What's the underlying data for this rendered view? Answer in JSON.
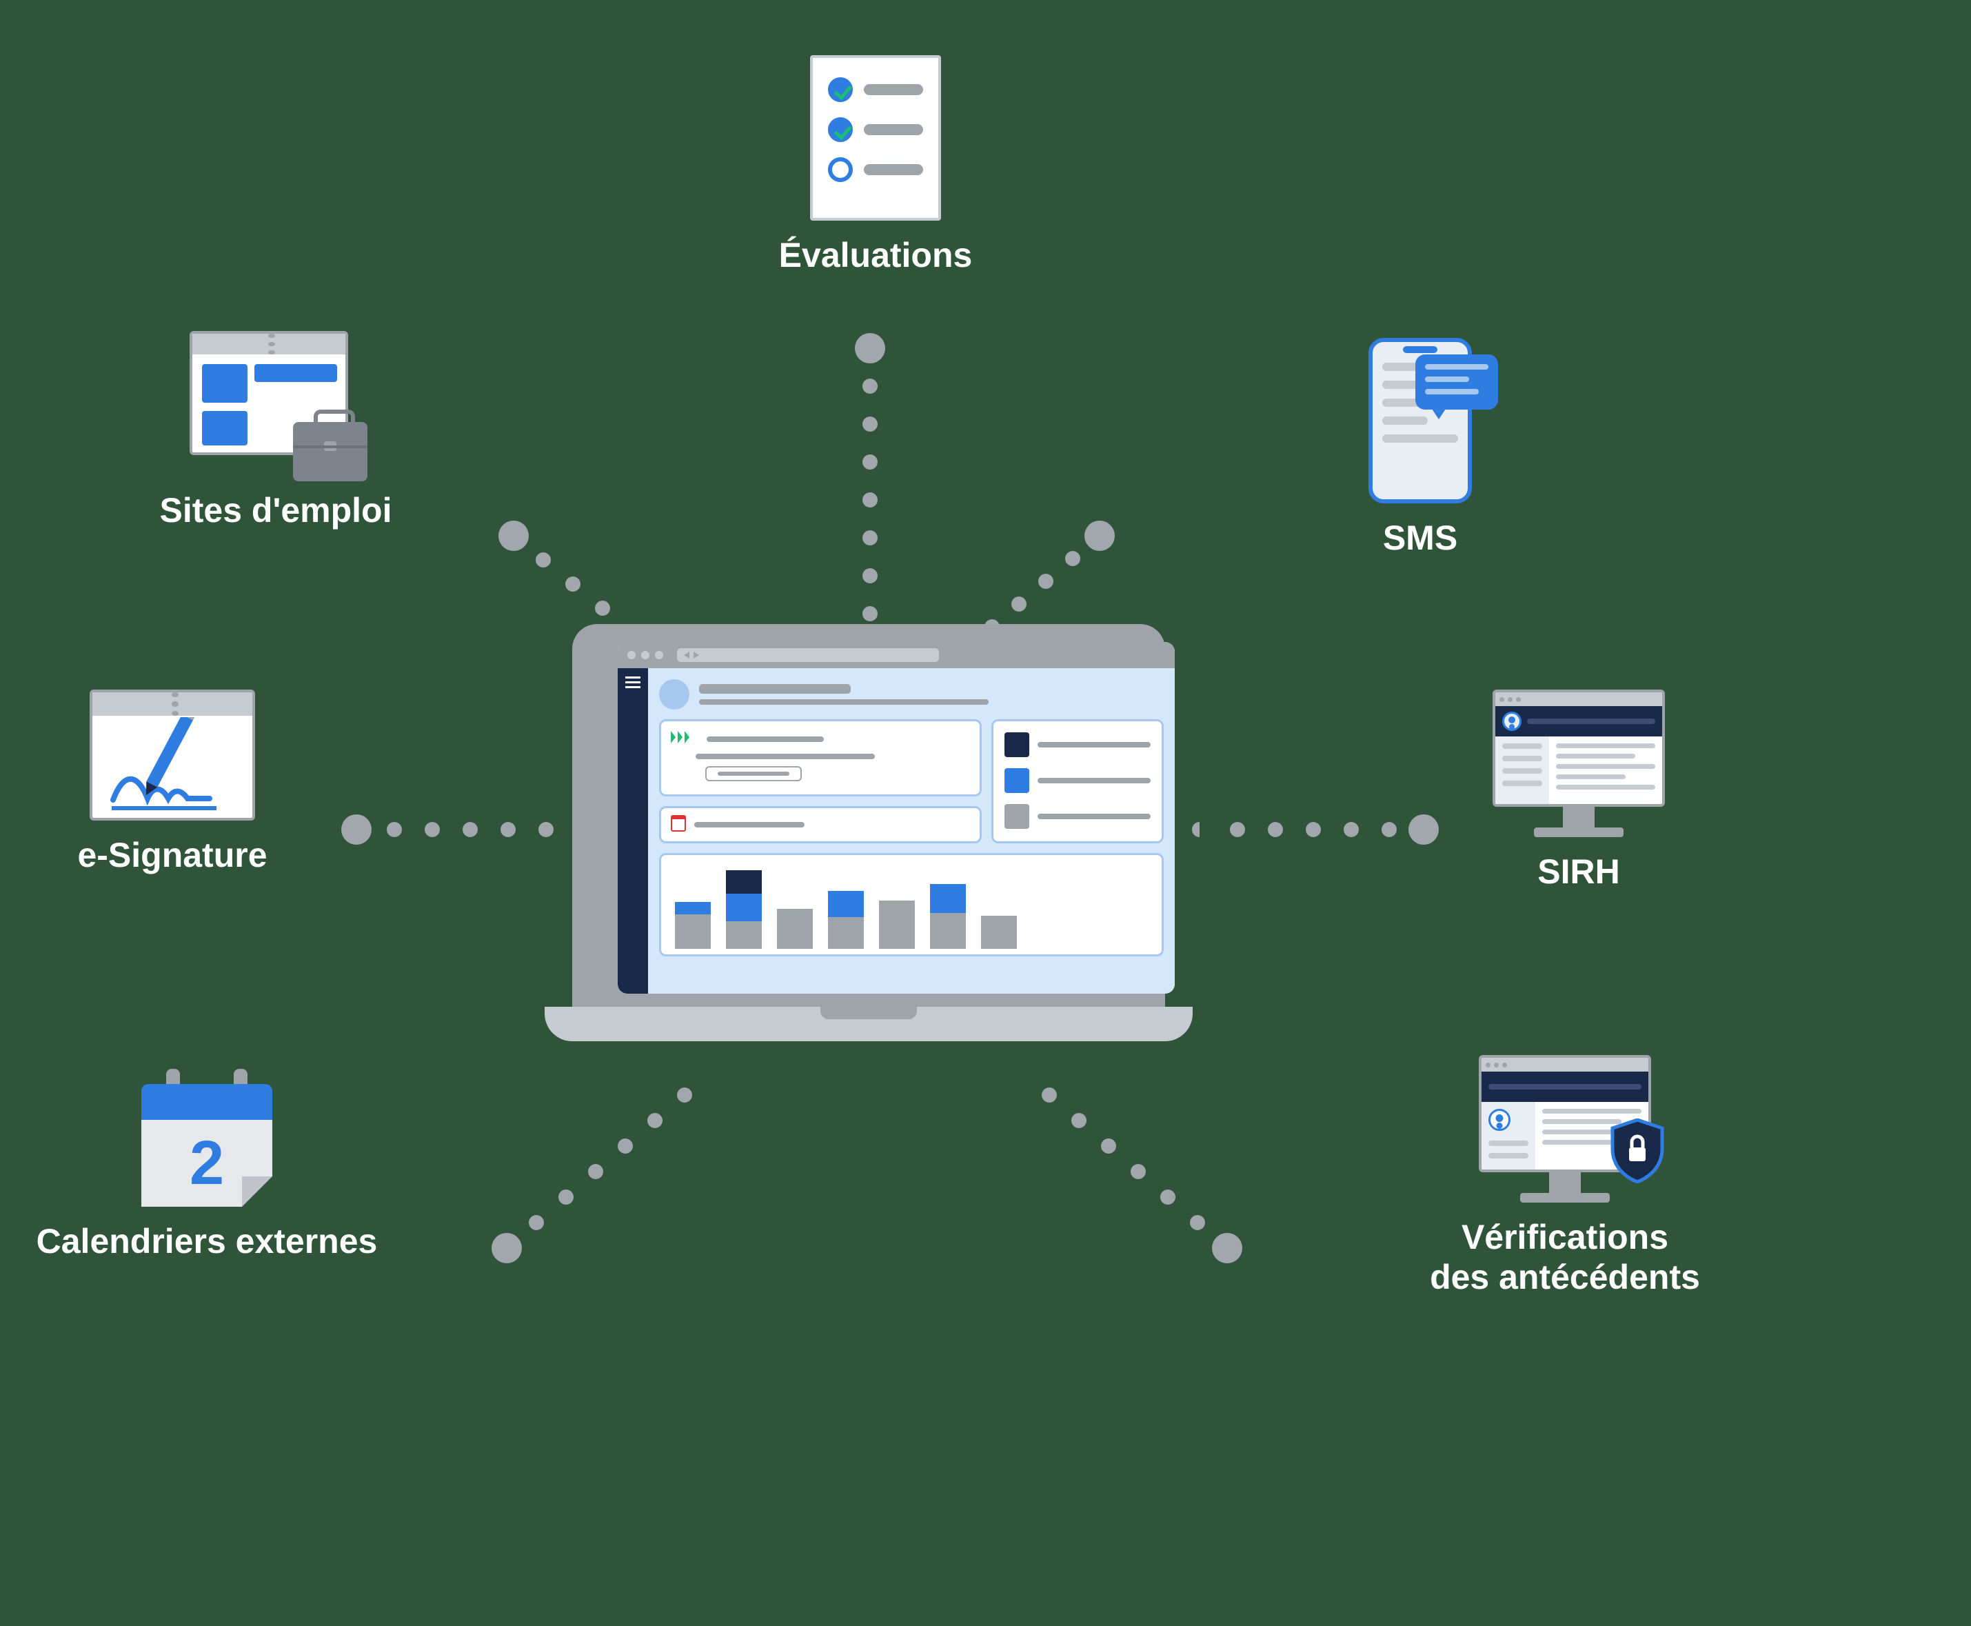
{
  "center": {
    "concept": "ATS / HR software dashboard on laptop",
    "ui": {
      "sidebar": "hamburger menu",
      "header_avatar": true,
      "cards": [
        "progress card with button",
        "calendar event card"
      ],
      "right_tiles": [
        "navy",
        "blue",
        "grey"
      ]
    }
  },
  "nodes": {
    "evaluations": {
      "label": "Évaluations"
    },
    "jobs": {
      "label": "Sites d'emploi"
    },
    "sms": {
      "label": "SMS"
    },
    "esign": {
      "label": "e-Signature"
    },
    "sirh": {
      "label": "SIRH"
    },
    "calendars": {
      "label": "Calendriers externes",
      "day_number": "2"
    },
    "background": {
      "label": "Vérifications\ndes antécédents"
    }
  },
  "chart_data": {
    "type": "bar",
    "note": "Decorative stacked bar chart inside the central laptop illustration. Values are relative pixel heights of stacked segments (grey bottom, blue middle, navy top).",
    "categories": [
      "b1",
      "b2",
      "b3",
      "b4",
      "b5",
      "b6",
      "b7"
    ],
    "series": [
      {
        "name": "grey",
        "values": [
          50,
          40,
          58,
          46,
          70,
          52,
          48
        ]
      },
      {
        "name": "blue",
        "values": [
          18,
          40,
          0,
          38,
          0,
          42,
          0
        ]
      },
      {
        "name": "navy",
        "values": [
          0,
          34,
          0,
          0,
          0,
          0,
          0
        ]
      }
    ],
    "ylim": [
      0,
      120
    ]
  },
  "colors": {
    "bg": "#2f543a",
    "blue": "#2f7de1",
    "navy": "#19294a",
    "grey": "#9fa4ab",
    "light": "#c6cbd1",
    "skyblue": "#a6c8ef",
    "white": "#ffffff"
  }
}
